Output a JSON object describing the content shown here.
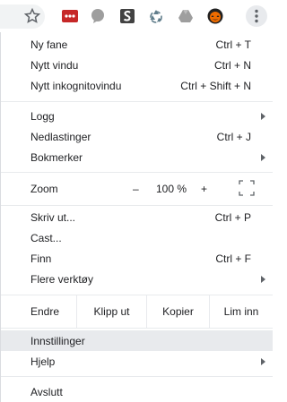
{
  "menu": {
    "items_top": [
      {
        "label": "Ny fane",
        "shortcut": "Ctrl + T"
      },
      {
        "label": "Nytt vindu",
        "shortcut": "Ctrl + N"
      },
      {
        "label": "Nytt inkognitovindu",
        "shortcut": "Ctrl + Shift + N"
      }
    ],
    "items_mid": [
      {
        "label": "Logg",
        "shortcut": ""
      },
      {
        "label": "Nedlastinger",
        "shortcut": "Ctrl + J"
      },
      {
        "label": "Bokmerker",
        "shortcut": ""
      }
    ],
    "zoom": {
      "label": "Zoom",
      "minus": "–",
      "value": "100 %",
      "plus": "+"
    },
    "items_tools": [
      {
        "label": "Skriv ut...",
        "shortcut": "Ctrl + P"
      },
      {
        "label": "Cast...",
        "shortcut": ""
      },
      {
        "label": "Finn",
        "shortcut": "Ctrl + F"
      },
      {
        "label": "Flere verktøy",
        "shortcut": ""
      }
    ],
    "edit": {
      "label": "Endre",
      "cut": "Klipp ut",
      "copy": "Kopier",
      "paste": "Lim inn"
    },
    "items_bottom": [
      {
        "label": "Innstillinger"
      },
      {
        "label": "Hjelp"
      }
    ],
    "exit": {
      "label": "Avslutt"
    }
  },
  "colors": {
    "highlight": "#e8eaed",
    "separator": "#e8eaed",
    "text": "#202124"
  },
  "toolbar": {
    "icons": [
      "star-icon",
      "lastpass-icon",
      "speech-bubble-icon",
      "s-extension-icon",
      "recycle-icon",
      "drive-icon",
      "pumpkin-icon",
      "three-dots-menu-icon"
    ]
  }
}
